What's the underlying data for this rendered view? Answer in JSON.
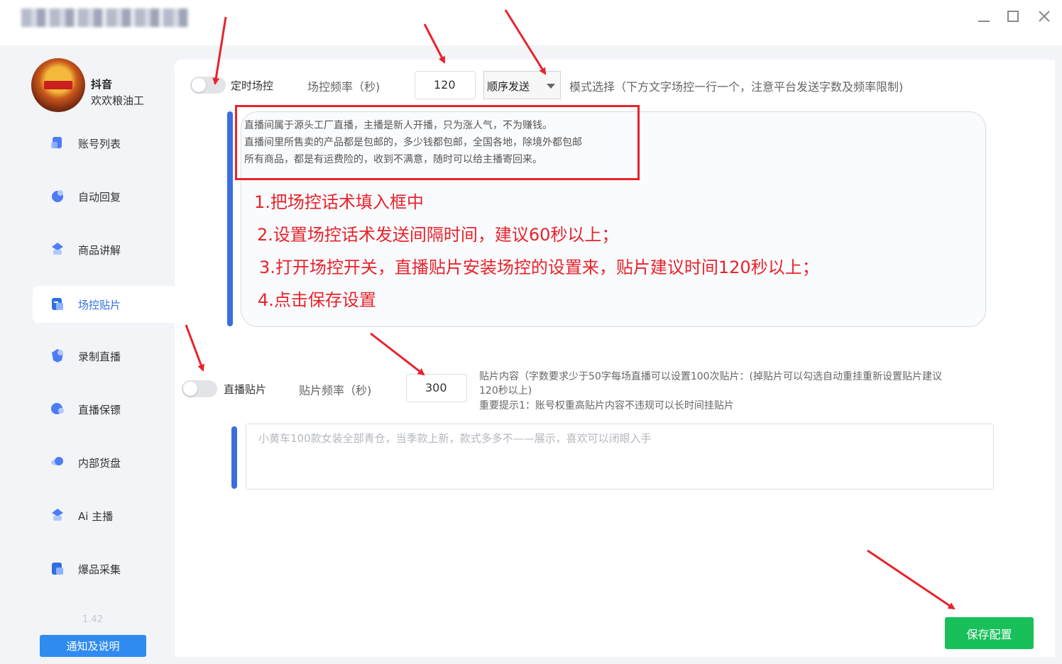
{
  "window": {
    "minimize_icon": "minimize-icon",
    "maximize_icon": "maximize-icon",
    "close_icon": "close-icon"
  },
  "account": {
    "platform": "抖音",
    "name": "欢欢粮油工"
  },
  "sidebar": {
    "items": [
      {
        "label": "账号列表",
        "icon": "user-list-icon"
      },
      {
        "label": "自动回复",
        "icon": "auto-reply-icon"
      },
      {
        "label": "商品讲解",
        "icon": "product-explain-icon"
      },
      {
        "label": "场控贴片",
        "icon": "overlay-control-icon"
      },
      {
        "label": "录制直播",
        "icon": "record-live-icon"
      },
      {
        "label": "直播保镖",
        "icon": "live-guard-icon"
      },
      {
        "label": "内部货盘",
        "icon": "inventory-icon"
      },
      {
        "label": "Ai 主播",
        "icon": "ai-host-icon"
      },
      {
        "label": "爆品采集",
        "icon": "hot-product-icon"
      }
    ],
    "active_index": 3,
    "version": "1.42",
    "notice_button": "通知及说明"
  },
  "field_control": {
    "toggle_label": "定时场控",
    "toggle_on": false,
    "frequency_label": "场控频率（秒)",
    "frequency_value": "120",
    "mode_value": "顺序发送",
    "mode_hint": "模式选择（下方文字场控一行一个，注意平台发送字数及频率限制)",
    "script_lines": [
      "直播间属于源头工厂直播，主播是新人开播，只为涨人气，不为赚钱。",
      "直播间里所售卖的产品都是包邮的，多少钱都包邮，全国各地，除境外都包邮",
      "所有商品，都是有运费险的，收到不满意，随时可以给主播寄回来。"
    ],
    "instructions": [
      "1.把场控话术填入框中",
      "2.设置场控话术发送间隔时间，建议60秒以上；",
      "3.打开场控开关，直播贴片安装场控的设置来，贴片建议时间120秒以上；",
      "4.点击保存设置"
    ]
  },
  "overlay": {
    "toggle_label": "直播贴片",
    "toggle_on": false,
    "frequency_label": "贴片频率（秒)",
    "frequency_value": "300",
    "notes": [
      "贴片内容（字数要求少于50字每场直播可以设置100次贴片：(掉贴片可以勾选自动重挂重新设置贴片建议",
      "120秒以上)",
      "重要提示1：账号权重高贴片内容不违规可以长时间挂贴片"
    ],
    "placeholder": "小黄车100款女装全部青仓，当季款上新，款式多多不——展示，喜欢可以闭眼入手"
  },
  "save_button": "保存配置",
  "colors": {
    "accent": "#2f8bf0",
    "save": "#19c05a",
    "annotation": "#e8232b",
    "bar": "#3a6ee0"
  }
}
